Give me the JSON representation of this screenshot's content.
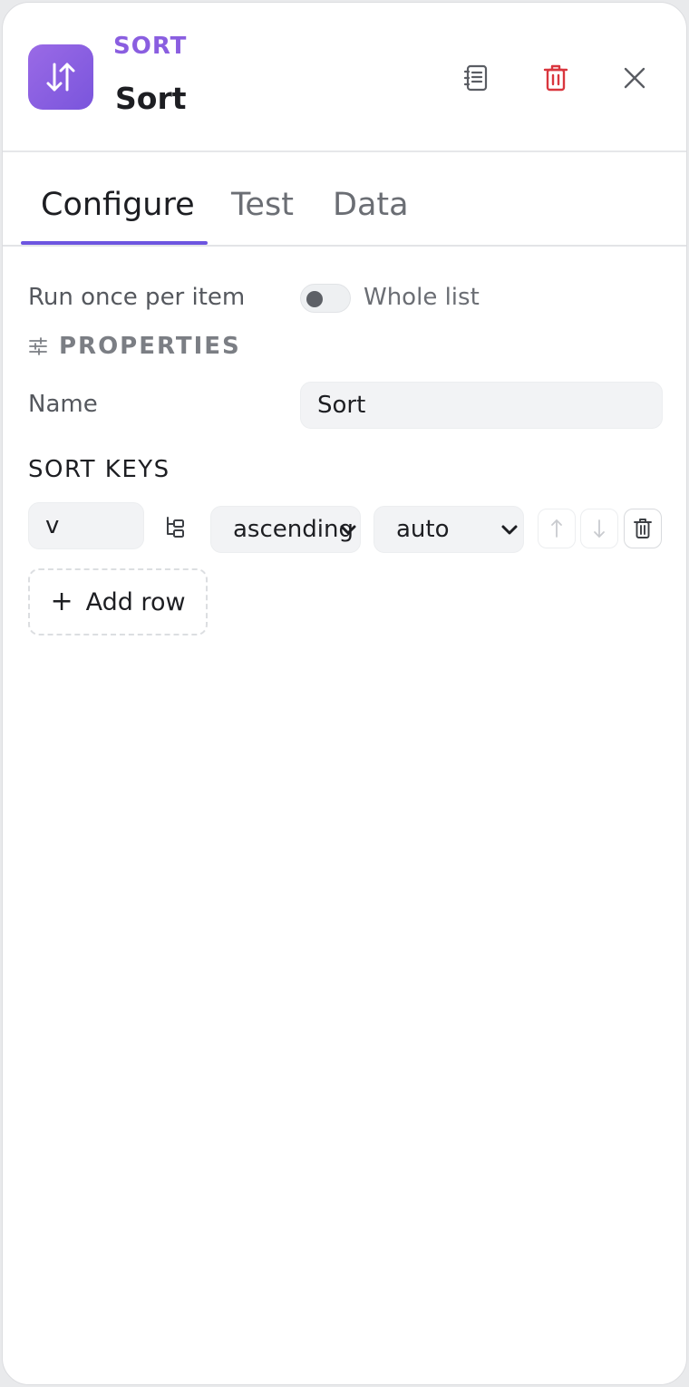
{
  "header": {
    "node_type": "SORT",
    "node_title": "Sort",
    "icons": {
      "node": "sort-arrows-icon",
      "docs": "docs-icon",
      "delete": "trash-icon",
      "close": "close-icon"
    },
    "accent_color": "#8a5ee0",
    "delete_color": "#d9363e"
  },
  "tabs": [
    {
      "label": "Configure",
      "active": true
    },
    {
      "label": "Test",
      "active": false
    },
    {
      "label": "Data",
      "active": false
    }
  ],
  "run_mode": {
    "label": "Run once per item",
    "toggle_on": false,
    "toggle_label": "Whole list"
  },
  "properties": {
    "title": "PROPERTIES",
    "icon": "sliders-icon",
    "name_label": "Name",
    "name_value": "Sort"
  },
  "sort_keys": {
    "title": "SORT KEYS",
    "rows": [
      {
        "key": "v",
        "order": "ascending",
        "mode": "auto"
      }
    ],
    "icons": {
      "tree": "tree-picker-icon",
      "up": "arrow-up-icon",
      "down": "arrow-down-icon",
      "remove": "trash-icon"
    },
    "add_row_label": "Add row",
    "add_icon": "plus-icon"
  }
}
